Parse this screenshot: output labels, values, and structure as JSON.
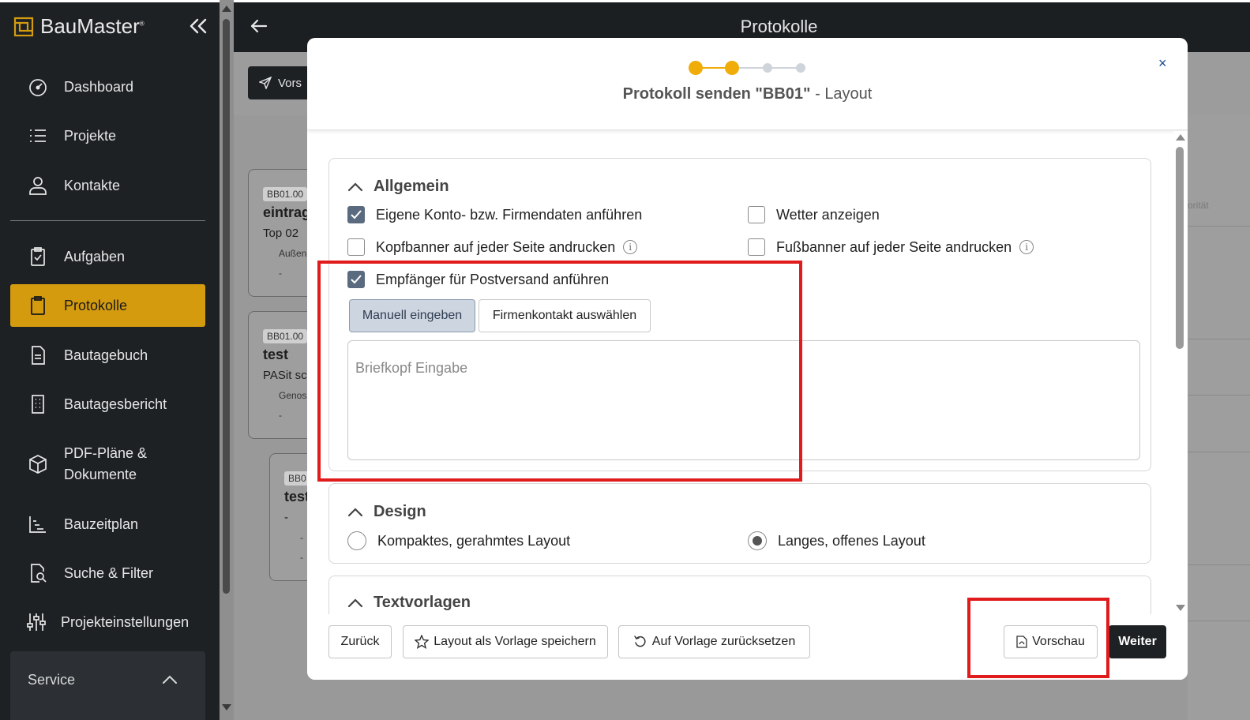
{
  "sidebar": {
    "brand": "BauMaster",
    "brand_mark": "®",
    "items": [
      {
        "label": "Dashboard",
        "icon": "dashboard-icon"
      },
      {
        "label": "Projekte",
        "icon": "list-icon"
      },
      {
        "label": "Kontakte",
        "icon": "user-icon"
      },
      {
        "label": "Aufgaben",
        "icon": "clipboard-check-icon"
      },
      {
        "label": "Protokolle",
        "icon": "clipboard-icon",
        "active": true
      },
      {
        "label": "Bautagebuch",
        "icon": "document-icon"
      },
      {
        "label": "Bautagesbericht",
        "icon": "building-icon"
      },
      {
        "label": "PDF-Pläne & Dokumente",
        "line1": "PDF-Pläne &",
        "line2": "Dokumente",
        "icon": "cube-icon"
      },
      {
        "label": "Bauzeitplan",
        "icon": "chart-icon"
      },
      {
        "label": "Suche & Filter",
        "icon": "search-document-icon"
      },
      {
        "label": "Projekteinstellungen",
        "icon": "sliders-icon"
      }
    ],
    "service_label": "Service"
  },
  "header": {
    "title": "Protokolle"
  },
  "background": {
    "send_label": "Vors",
    "cards": [
      {
        "tag": "BB01.00",
        "title": "eintrag",
        "sub": "Top 02",
        "meta": "Außen",
        "flag": "-"
      },
      {
        "tag": "BB01.00",
        "title": "test",
        "sub": "PASit sc",
        "meta": "Genos",
        "flag": "-"
      },
      {
        "tag": "BB0",
        "title": "test",
        "sub": "-",
        "meta": "-",
        "flag": "-"
      }
    ],
    "right_text": "orität"
  },
  "modal": {
    "title_bold": "Protokoll senden \"BB01\"",
    "title_sep": " - ",
    "title_rest": "Layout",
    "close": "×",
    "steps_total": 4,
    "steps_done": 2,
    "sections": {
      "allgemein": {
        "title": "Allgemein",
        "options": [
          {
            "label": "Eigene Konto- bzw. Firmendaten anführen",
            "checked": true
          },
          {
            "label": "Wetter anzeigen",
            "checked": false
          },
          {
            "label": "Kopfbanner auf jeder Seite andrucken",
            "checked": false,
            "info": "i"
          },
          {
            "label": "Fußbanner auf jeder Seite andrucken",
            "checked": false,
            "info": "i"
          },
          {
            "label": "Empfänger für Postversand anführen",
            "checked": true
          }
        ],
        "toggle": [
          "Manuell eingeben",
          "Firmenkontakt auswählen"
        ],
        "textarea_placeholder": "Briefkopf Eingabe"
      },
      "design": {
        "title": "Design",
        "options": [
          {
            "label": "Kompaktes, gerahmtes Layout",
            "selected": false
          },
          {
            "label": "Langes, offenes Layout",
            "selected": true
          }
        ]
      },
      "textvorlagen": {
        "title": "Textvorlagen"
      }
    },
    "footer": {
      "back": "Zurück",
      "save_template": "Layout als Vorlage speichern",
      "reset_template": "Auf Vorlage zurücksetzen",
      "preview": "Vorschau",
      "next": "Weiter"
    }
  },
  "colors": {
    "accent": "#d49b0f",
    "sidebar_bg": "#1e2124",
    "highlight_red": "#e01b1b",
    "step_active": "#f0ad0a"
  }
}
